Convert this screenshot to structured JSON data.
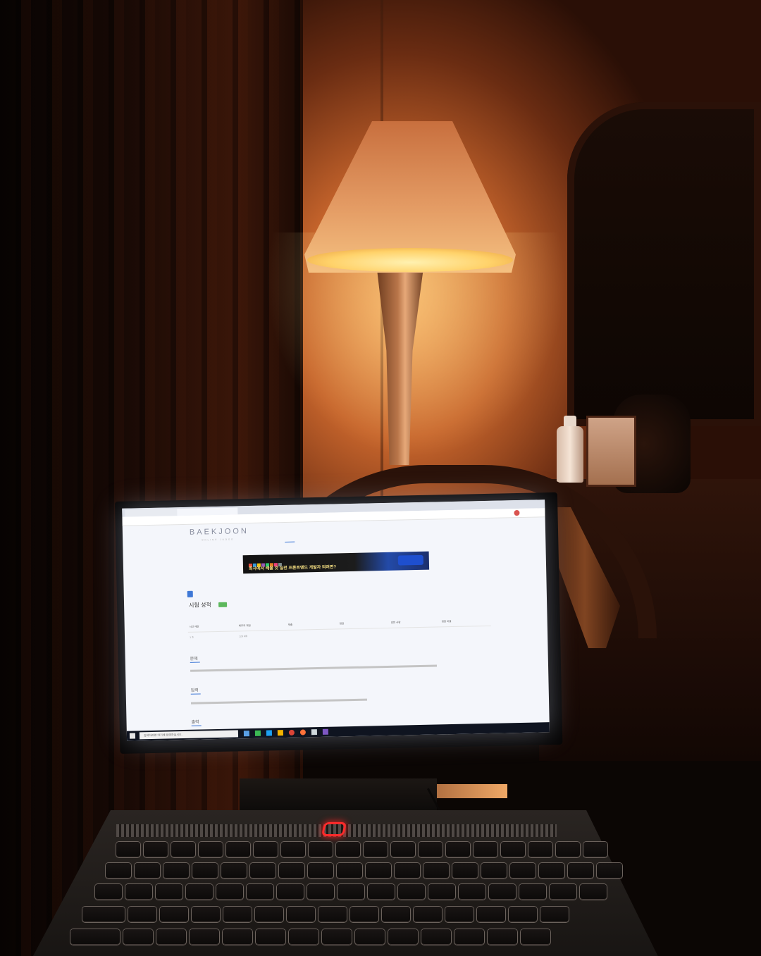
{
  "browser": {
    "tab_1": "",
    "tab_2": "",
    "url": ""
  },
  "site": {
    "logo": "BAEKJOON",
    "logo_sub": "ONLINE JUDGE",
    "nav": [
      "",
      "",
      "",
      "",
      "",
      "",
      "",
      "",
      "",
      "",
      ""
    ]
  },
  "banner": {
    "headline": "회사에서 배울 것 실전 프론트엔드 개발자 되려면?",
    "button": ""
  },
  "problem": {
    "tabs": [
      "",
      "",
      "",
      "",
      "",
      "",
      "",
      "",
      "",
      "",
      "",
      "",
      "",
      ""
    ],
    "title": "시험 성적",
    "badge": "",
    "table_headers": [
      "시간 제한",
      "메모리 제한",
      "제출",
      "정답",
      "맞힌 사람",
      "정답 비율"
    ],
    "table_values": [
      "1 초",
      "128 MB",
      "",
      "",
      "",
      ""
    ],
    "section_problem": "문제",
    "problem_text": "",
    "section_input": "입력",
    "input_text": "",
    "section_output": "출력"
  },
  "taskbar": {
    "search_placeholder": "검색하려면 여기에 입력하십시오.",
    "time": "",
    "date": ""
  },
  "colors": {
    "lamp_glow": "#f5c181",
    "screen": "#f4f6fb",
    "accent_blue": "#3e78d6",
    "power_led": "#ff2a2a"
  }
}
